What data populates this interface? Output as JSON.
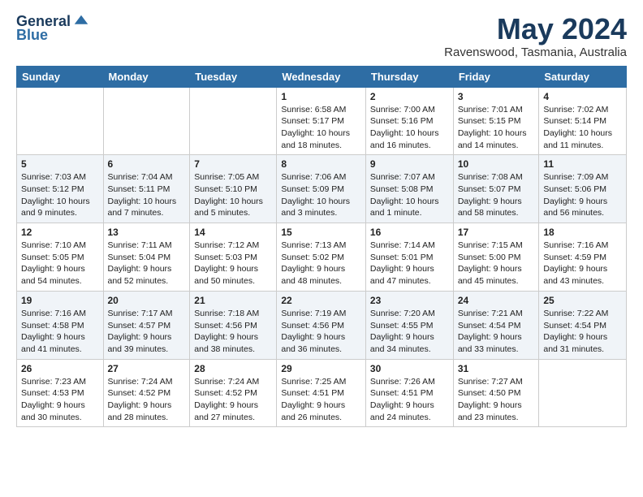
{
  "header": {
    "logo_line1": "General",
    "logo_line2": "Blue",
    "month_title": "May 2024",
    "location": "Ravenswood, Tasmania, Australia"
  },
  "days_of_week": [
    "Sunday",
    "Monday",
    "Tuesday",
    "Wednesday",
    "Thursday",
    "Friday",
    "Saturday"
  ],
  "weeks": [
    [
      {
        "day": "",
        "info": ""
      },
      {
        "day": "",
        "info": ""
      },
      {
        "day": "",
        "info": ""
      },
      {
        "day": "1",
        "info": "Sunrise: 6:58 AM\nSunset: 5:17 PM\nDaylight: 10 hours\nand 18 minutes."
      },
      {
        "day": "2",
        "info": "Sunrise: 7:00 AM\nSunset: 5:16 PM\nDaylight: 10 hours\nand 16 minutes."
      },
      {
        "day": "3",
        "info": "Sunrise: 7:01 AM\nSunset: 5:15 PM\nDaylight: 10 hours\nand 14 minutes."
      },
      {
        "day": "4",
        "info": "Sunrise: 7:02 AM\nSunset: 5:14 PM\nDaylight: 10 hours\nand 11 minutes."
      }
    ],
    [
      {
        "day": "5",
        "info": "Sunrise: 7:03 AM\nSunset: 5:12 PM\nDaylight: 10 hours\nand 9 minutes."
      },
      {
        "day": "6",
        "info": "Sunrise: 7:04 AM\nSunset: 5:11 PM\nDaylight: 10 hours\nand 7 minutes."
      },
      {
        "day": "7",
        "info": "Sunrise: 7:05 AM\nSunset: 5:10 PM\nDaylight: 10 hours\nand 5 minutes."
      },
      {
        "day": "8",
        "info": "Sunrise: 7:06 AM\nSunset: 5:09 PM\nDaylight: 10 hours\nand 3 minutes."
      },
      {
        "day": "9",
        "info": "Sunrise: 7:07 AM\nSunset: 5:08 PM\nDaylight: 10 hours\nand 1 minute."
      },
      {
        "day": "10",
        "info": "Sunrise: 7:08 AM\nSunset: 5:07 PM\nDaylight: 9 hours\nand 58 minutes."
      },
      {
        "day": "11",
        "info": "Sunrise: 7:09 AM\nSunset: 5:06 PM\nDaylight: 9 hours\nand 56 minutes."
      }
    ],
    [
      {
        "day": "12",
        "info": "Sunrise: 7:10 AM\nSunset: 5:05 PM\nDaylight: 9 hours\nand 54 minutes."
      },
      {
        "day": "13",
        "info": "Sunrise: 7:11 AM\nSunset: 5:04 PM\nDaylight: 9 hours\nand 52 minutes."
      },
      {
        "day": "14",
        "info": "Sunrise: 7:12 AM\nSunset: 5:03 PM\nDaylight: 9 hours\nand 50 minutes."
      },
      {
        "day": "15",
        "info": "Sunrise: 7:13 AM\nSunset: 5:02 PM\nDaylight: 9 hours\nand 48 minutes."
      },
      {
        "day": "16",
        "info": "Sunrise: 7:14 AM\nSunset: 5:01 PM\nDaylight: 9 hours\nand 47 minutes."
      },
      {
        "day": "17",
        "info": "Sunrise: 7:15 AM\nSunset: 5:00 PM\nDaylight: 9 hours\nand 45 minutes."
      },
      {
        "day": "18",
        "info": "Sunrise: 7:16 AM\nSunset: 4:59 PM\nDaylight: 9 hours\nand 43 minutes."
      }
    ],
    [
      {
        "day": "19",
        "info": "Sunrise: 7:16 AM\nSunset: 4:58 PM\nDaylight: 9 hours\nand 41 minutes."
      },
      {
        "day": "20",
        "info": "Sunrise: 7:17 AM\nSunset: 4:57 PM\nDaylight: 9 hours\nand 39 minutes."
      },
      {
        "day": "21",
        "info": "Sunrise: 7:18 AM\nSunset: 4:56 PM\nDaylight: 9 hours\nand 38 minutes."
      },
      {
        "day": "22",
        "info": "Sunrise: 7:19 AM\nSunset: 4:56 PM\nDaylight: 9 hours\nand 36 minutes."
      },
      {
        "day": "23",
        "info": "Sunrise: 7:20 AM\nSunset: 4:55 PM\nDaylight: 9 hours\nand 34 minutes."
      },
      {
        "day": "24",
        "info": "Sunrise: 7:21 AM\nSunset: 4:54 PM\nDaylight: 9 hours\nand 33 minutes."
      },
      {
        "day": "25",
        "info": "Sunrise: 7:22 AM\nSunset: 4:54 PM\nDaylight: 9 hours\nand 31 minutes."
      }
    ],
    [
      {
        "day": "26",
        "info": "Sunrise: 7:23 AM\nSunset: 4:53 PM\nDaylight: 9 hours\nand 30 minutes."
      },
      {
        "day": "27",
        "info": "Sunrise: 7:24 AM\nSunset: 4:52 PM\nDaylight: 9 hours\nand 28 minutes."
      },
      {
        "day": "28",
        "info": "Sunrise: 7:24 AM\nSunset: 4:52 PM\nDaylight: 9 hours\nand 27 minutes."
      },
      {
        "day": "29",
        "info": "Sunrise: 7:25 AM\nSunset: 4:51 PM\nDaylight: 9 hours\nand 26 minutes."
      },
      {
        "day": "30",
        "info": "Sunrise: 7:26 AM\nSunset: 4:51 PM\nDaylight: 9 hours\nand 24 minutes."
      },
      {
        "day": "31",
        "info": "Sunrise: 7:27 AM\nSunset: 4:50 PM\nDaylight: 9 hours\nand 23 minutes."
      },
      {
        "day": "",
        "info": ""
      }
    ]
  ]
}
